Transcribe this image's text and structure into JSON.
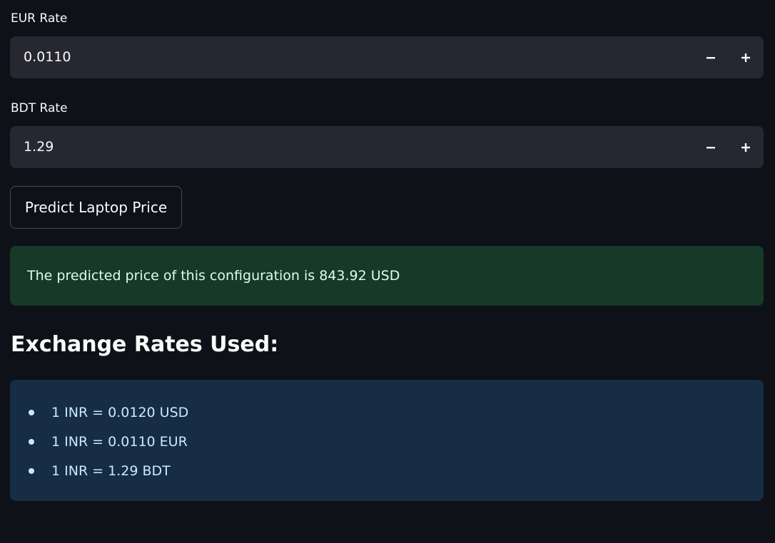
{
  "eur_rate": {
    "label": "EUR Rate",
    "value": "0.0110"
  },
  "bdt_rate": {
    "label": "BDT Rate",
    "value": "1.29"
  },
  "predict_button": {
    "label": "Predict Laptop Price"
  },
  "result": {
    "message": "The predicted price of this configuration is 843.92 USD"
  },
  "exchange": {
    "heading": "Exchange Rates Used:",
    "items": [
      "1 INR = 0.0120 USD",
      "1 INR = 0.0110 EUR",
      "1 INR = 1.29 BDT"
    ]
  },
  "colors": {
    "background": "#0e1117",
    "input_bg": "#262730",
    "success_bg": "#173928",
    "info_bg": "#172d43"
  },
  "icons": {
    "decrement": "minus-icon",
    "increment": "plus-icon"
  }
}
